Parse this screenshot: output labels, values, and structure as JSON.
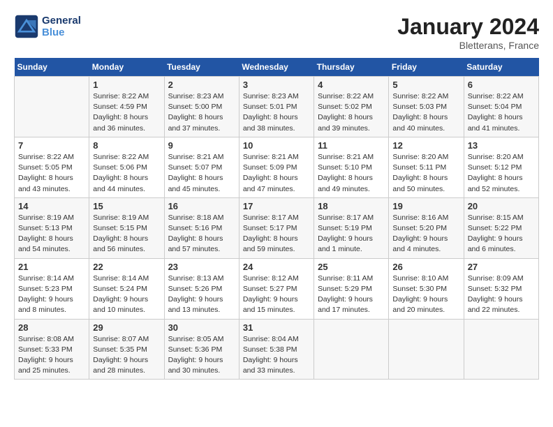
{
  "header": {
    "logo_line1": "General",
    "logo_line2": "Blue",
    "month_year": "January 2024",
    "location": "Bletterans, France"
  },
  "days_of_week": [
    "Sunday",
    "Monday",
    "Tuesday",
    "Wednesday",
    "Thursday",
    "Friday",
    "Saturday"
  ],
  "weeks": [
    [
      {
        "num": "",
        "text": ""
      },
      {
        "num": "1",
        "text": "Sunrise: 8:22 AM\nSunset: 4:59 PM\nDaylight: 8 hours\nand 36 minutes."
      },
      {
        "num": "2",
        "text": "Sunrise: 8:23 AM\nSunset: 5:00 PM\nDaylight: 8 hours\nand 37 minutes."
      },
      {
        "num": "3",
        "text": "Sunrise: 8:23 AM\nSunset: 5:01 PM\nDaylight: 8 hours\nand 38 minutes."
      },
      {
        "num": "4",
        "text": "Sunrise: 8:22 AM\nSunset: 5:02 PM\nDaylight: 8 hours\nand 39 minutes."
      },
      {
        "num": "5",
        "text": "Sunrise: 8:22 AM\nSunset: 5:03 PM\nDaylight: 8 hours\nand 40 minutes."
      },
      {
        "num": "6",
        "text": "Sunrise: 8:22 AM\nSunset: 5:04 PM\nDaylight: 8 hours\nand 41 minutes."
      }
    ],
    [
      {
        "num": "7",
        "text": "Sunrise: 8:22 AM\nSunset: 5:05 PM\nDaylight: 8 hours\nand 43 minutes."
      },
      {
        "num": "8",
        "text": "Sunrise: 8:22 AM\nSunset: 5:06 PM\nDaylight: 8 hours\nand 44 minutes."
      },
      {
        "num": "9",
        "text": "Sunrise: 8:21 AM\nSunset: 5:07 PM\nDaylight: 8 hours\nand 45 minutes."
      },
      {
        "num": "10",
        "text": "Sunrise: 8:21 AM\nSunset: 5:09 PM\nDaylight: 8 hours\nand 47 minutes."
      },
      {
        "num": "11",
        "text": "Sunrise: 8:21 AM\nSunset: 5:10 PM\nDaylight: 8 hours\nand 49 minutes."
      },
      {
        "num": "12",
        "text": "Sunrise: 8:20 AM\nSunset: 5:11 PM\nDaylight: 8 hours\nand 50 minutes."
      },
      {
        "num": "13",
        "text": "Sunrise: 8:20 AM\nSunset: 5:12 PM\nDaylight: 8 hours\nand 52 minutes."
      }
    ],
    [
      {
        "num": "14",
        "text": "Sunrise: 8:19 AM\nSunset: 5:13 PM\nDaylight: 8 hours\nand 54 minutes."
      },
      {
        "num": "15",
        "text": "Sunrise: 8:19 AM\nSunset: 5:15 PM\nDaylight: 8 hours\nand 56 minutes."
      },
      {
        "num": "16",
        "text": "Sunrise: 8:18 AM\nSunset: 5:16 PM\nDaylight: 8 hours\nand 57 minutes."
      },
      {
        "num": "17",
        "text": "Sunrise: 8:17 AM\nSunset: 5:17 PM\nDaylight: 8 hours\nand 59 minutes."
      },
      {
        "num": "18",
        "text": "Sunrise: 8:17 AM\nSunset: 5:19 PM\nDaylight: 9 hours\nand 1 minute."
      },
      {
        "num": "19",
        "text": "Sunrise: 8:16 AM\nSunset: 5:20 PM\nDaylight: 9 hours\nand 4 minutes."
      },
      {
        "num": "20",
        "text": "Sunrise: 8:15 AM\nSunset: 5:22 PM\nDaylight: 9 hours\nand 6 minutes."
      }
    ],
    [
      {
        "num": "21",
        "text": "Sunrise: 8:14 AM\nSunset: 5:23 PM\nDaylight: 9 hours\nand 8 minutes."
      },
      {
        "num": "22",
        "text": "Sunrise: 8:14 AM\nSunset: 5:24 PM\nDaylight: 9 hours\nand 10 minutes."
      },
      {
        "num": "23",
        "text": "Sunrise: 8:13 AM\nSunset: 5:26 PM\nDaylight: 9 hours\nand 13 minutes."
      },
      {
        "num": "24",
        "text": "Sunrise: 8:12 AM\nSunset: 5:27 PM\nDaylight: 9 hours\nand 15 minutes."
      },
      {
        "num": "25",
        "text": "Sunrise: 8:11 AM\nSunset: 5:29 PM\nDaylight: 9 hours\nand 17 minutes."
      },
      {
        "num": "26",
        "text": "Sunrise: 8:10 AM\nSunset: 5:30 PM\nDaylight: 9 hours\nand 20 minutes."
      },
      {
        "num": "27",
        "text": "Sunrise: 8:09 AM\nSunset: 5:32 PM\nDaylight: 9 hours\nand 22 minutes."
      }
    ],
    [
      {
        "num": "28",
        "text": "Sunrise: 8:08 AM\nSunset: 5:33 PM\nDaylight: 9 hours\nand 25 minutes."
      },
      {
        "num": "29",
        "text": "Sunrise: 8:07 AM\nSunset: 5:35 PM\nDaylight: 9 hours\nand 28 minutes."
      },
      {
        "num": "30",
        "text": "Sunrise: 8:05 AM\nSunset: 5:36 PM\nDaylight: 9 hours\nand 30 minutes."
      },
      {
        "num": "31",
        "text": "Sunrise: 8:04 AM\nSunset: 5:38 PM\nDaylight: 9 hours\nand 33 minutes."
      },
      {
        "num": "",
        "text": ""
      },
      {
        "num": "",
        "text": ""
      },
      {
        "num": "",
        "text": ""
      }
    ]
  ]
}
